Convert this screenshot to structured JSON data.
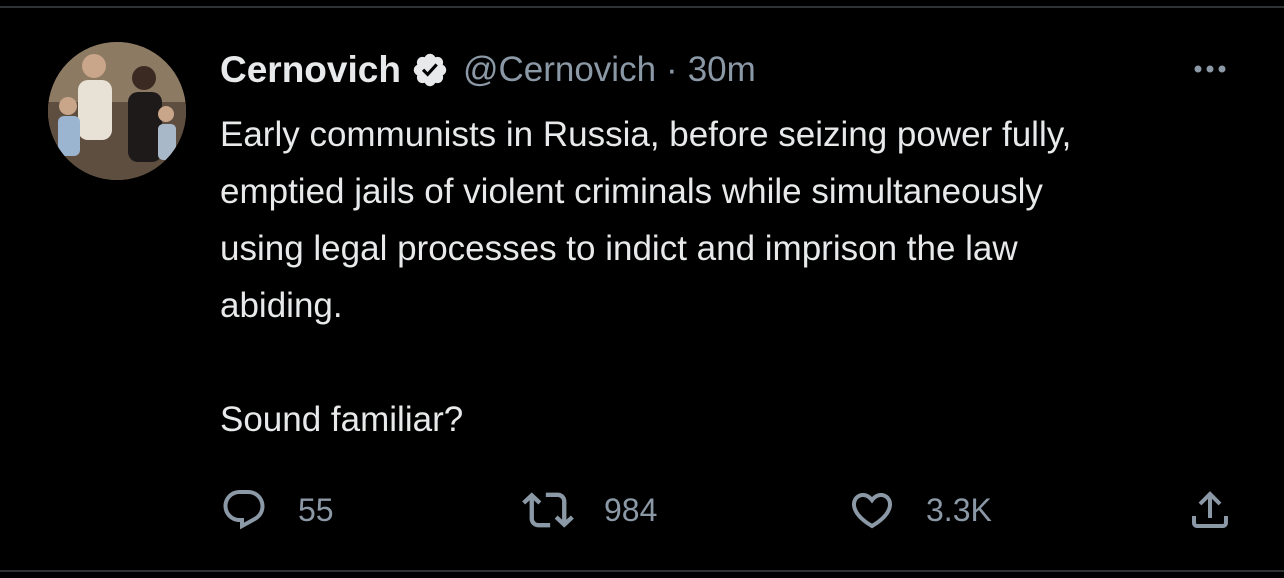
{
  "tweet": {
    "author": {
      "display_name": "Cernovich",
      "handle": "@Cernovich",
      "verified": true
    },
    "separator": "·",
    "timestamp": "30m",
    "text": "Early communists in Russia, before seizing power fully,\nemptied jails of violent criminals while simultaneously\nusing legal processes to indict and imprison the law\nabiding.\n\nSound familiar?",
    "stats": {
      "replies": "55",
      "retweets": "984",
      "likes": "3.3K"
    }
  },
  "icons": {
    "more": "more-horizontal-icon",
    "reply": "reply-icon",
    "retweet": "retweet-icon",
    "like": "heart-icon",
    "share": "share-icon",
    "verified": "verified-badge-icon"
  },
  "colors": {
    "background": "#000000",
    "primary_text": "#e7e9ea",
    "secondary_text": "#8b98a5",
    "divider": "#2f3336"
  }
}
